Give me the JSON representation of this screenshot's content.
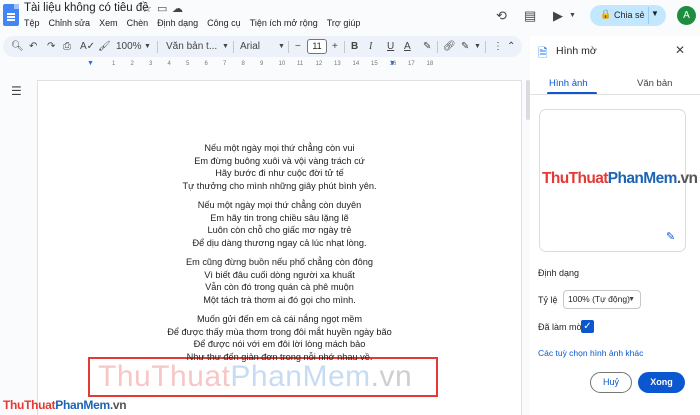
{
  "header": {
    "doc_title": "Tài liệu không có tiêu đề",
    "menu": [
      "Tệp",
      "Chỉnh sửa",
      "Xem",
      "Chèn",
      "Định dạng",
      "Công cụ",
      "Tiện ích mở rộng",
      "Trợ giúp"
    ],
    "share_label": "Chia sẻ",
    "avatar_initial": "A"
  },
  "toolbar": {
    "zoom": "100%",
    "style": "Văn bản t...",
    "font": "Arial",
    "font_size": "11"
  },
  "ruler": {
    "ticks": [
      "1",
      "2",
      "3",
      "4",
      "5",
      "6",
      "7",
      "8",
      "9",
      "10",
      "11",
      "12",
      "13",
      "14",
      "15",
      "16",
      "17",
      "18"
    ]
  },
  "document": {
    "stanzas": [
      [
        "Nếu một ngày mọi thứ chẳng còn vui",
        "Em đừng buông xuôi và vội vàng trách cứ",
        "Hãy bước đi như cuộc đời tử tế",
        "Tự thưởng cho mình những giây phút bình yên."
      ],
      [
        "Nếu một ngày mọi thứ chẳng còn duyên",
        "Em hãy tin trong chiều sâu lặng lẽ",
        "Luôn còn chỗ cho giấc mơ ngày trẻ",
        "Để dịu dàng thương ngay cả lúc nhạt lòng."
      ],
      [
        "Em cũng đừng buồn nếu phố chẳng còn đông",
        "Vì biết đâu cuối dòng người xa khuất",
        "Vẫn còn đó trong quán cà phê muộn",
        "Một tách trà thơm ai đó gọi cho mình."
      ],
      [
        "Muốn gửi đến em cả cái nắng ngọt mềm",
        "Để được thấy mùa thơm trong đôi mắt huyền ngày bão",
        "Để được nói với em đôi lời lòng mách bảo",
        "Như thư đến giản đơn trong nỗi nhớ nhau về."
      ]
    ],
    "watermark": {
      "part1": "ThuThuat",
      "part2": "PhanMem",
      "part3": ".vn"
    }
  },
  "panel": {
    "title": "Hình mờ",
    "tabs": [
      "Hình ảnh",
      "Văn bản"
    ],
    "preview": {
      "part1": "ThuThuat",
      "part2": "PhanMem",
      "part3": ".vn"
    },
    "format_heading": "Định dạng",
    "scale_label": "Tỷ lệ",
    "scale_value": "100% (Tự động)",
    "faded_label": "Đã làm mờ",
    "faded_checked": true,
    "more_options": "Các tuỳ chọn hình ảnh khác",
    "cancel": "Huỷ",
    "done": "Xong"
  },
  "footer_logo": {
    "part1": "ThuThuat",
    "part2": "PhanMem",
    "part3": ".vn"
  },
  "colors": {
    "accent": "#0b57d0",
    "share_bg": "#c2e7ff",
    "watermark_box": "#e53935"
  }
}
